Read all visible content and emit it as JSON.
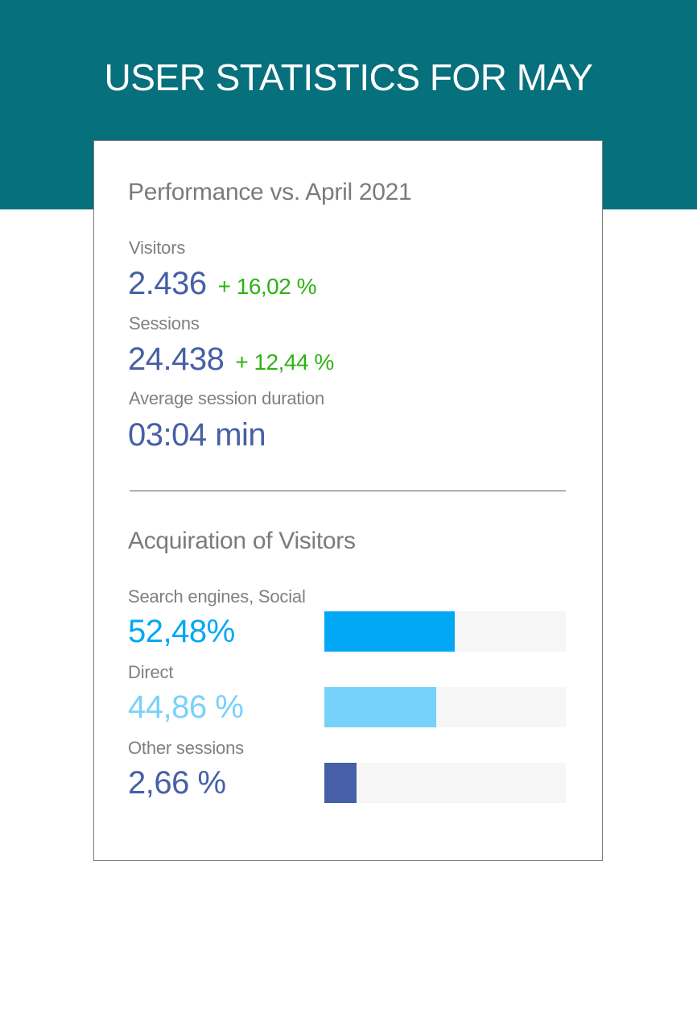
{
  "page": {
    "title": "USER STATISTICS FOR MAY"
  },
  "performance": {
    "title": "Performance vs. April 2021",
    "metrics": [
      {
        "label": "Visitors",
        "value": "2.436",
        "change": "+ 16,02 %"
      },
      {
        "label": "Sessions",
        "value": "24.438",
        "change": "+ 12,44 %"
      },
      {
        "label": "Average session duration",
        "value": "03:04 min",
        "change": ""
      }
    ]
  },
  "acquisition": {
    "title": "Acquiration of Visitors",
    "channels": [
      {
        "label": "Search engines, Social",
        "percent_text": "52,48%",
        "share": 0.5248,
        "color": "#03a8f5"
      },
      {
        "label": "Direct",
        "percent_text": "44,86 %",
        "share": 0.4486,
        "color": "#77d2fa"
      },
      {
        "label": "Other sessions",
        "percent_text": "2,66 %",
        "share": 0.0266,
        "color": "#475fa6"
      }
    ]
  },
  "colors": {
    "header_bg": "#06707d",
    "value_blue": "#475fa6",
    "change_green": "#2db314",
    "bar_track": "#f6f6f6"
  }
}
